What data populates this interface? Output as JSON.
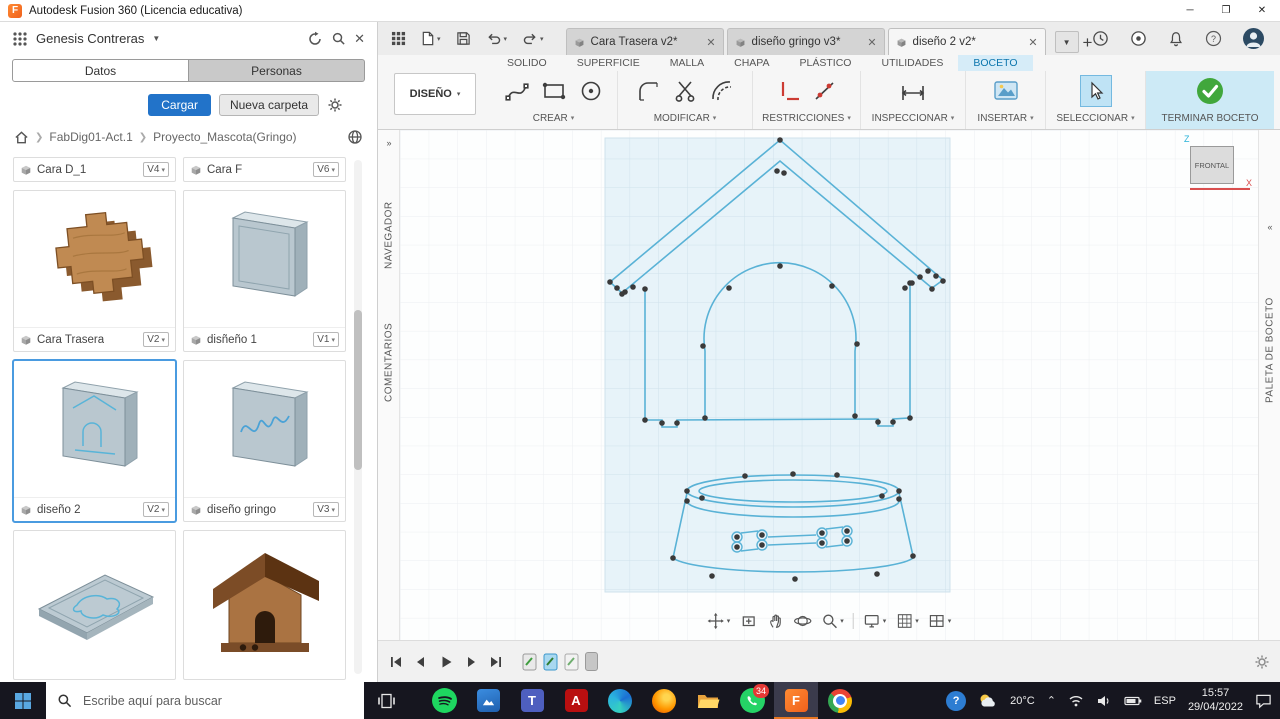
{
  "titlebar": {
    "title": "Autodesk Fusion 360 (Licencia educativa)"
  },
  "left_panel": {
    "user_name": "Genesis Contreras",
    "tabs": {
      "datos": "Datos",
      "personas": "Personas"
    },
    "upload_label": "Cargar",
    "new_folder_label": "Nueva carpeta",
    "breadcrumb": {
      "folder": "FabDig01-Act.1",
      "project": "Proyecto_Mascota(Gringo)"
    },
    "partial_items": [
      {
        "name": "Cara D_1",
        "version": "V4"
      },
      {
        "name": "Cara F",
        "version": "V6"
      }
    ],
    "items": [
      {
        "name": "Cara Trasera",
        "version": "V2"
      },
      {
        "name": "disñeño 1",
        "version": "V1"
      },
      {
        "name": "diseño 2",
        "version": "V2"
      },
      {
        "name": "diseño gringo",
        "version": "V3"
      }
    ]
  },
  "doc_toolbar": {
    "tabs": [
      {
        "label": "Cara Trasera v2*"
      },
      {
        "label": "diseño gringo v3*"
      },
      {
        "label": "diseño 2 v2*"
      }
    ]
  },
  "ribbon": {
    "workspace_selector": "DISEÑO",
    "tabs": [
      "SOLIDO",
      "SUPERFICIE",
      "MALLA",
      "CHAPA",
      "PLÁSTICO",
      "UTILIDADES",
      "BOCETO"
    ],
    "groups": {
      "create": "CREAR",
      "modify": "MODIFICAR",
      "constraints": "RESTRICCIONES",
      "inspect": "INSPECCIONAR",
      "insert": "INSERTAR",
      "select": "SELECCIONAR",
      "finish": "TERMINAR BOCETO"
    }
  },
  "panels": {
    "navigator": "NAVEGADOR",
    "comments": "COMENTARIOS",
    "sketch_palette": "PALETA DE BOCETO"
  },
  "viewcube": {
    "face": "FRONTAL",
    "axis_z": "Z",
    "axis_x": "X"
  },
  "taskbar": {
    "search_placeholder": "Escribe aquí para buscar",
    "whatsapp_badge": "34",
    "weather_temp": "20°C",
    "language": "ESP",
    "time": "15:57",
    "date": "29/04/2022"
  }
}
